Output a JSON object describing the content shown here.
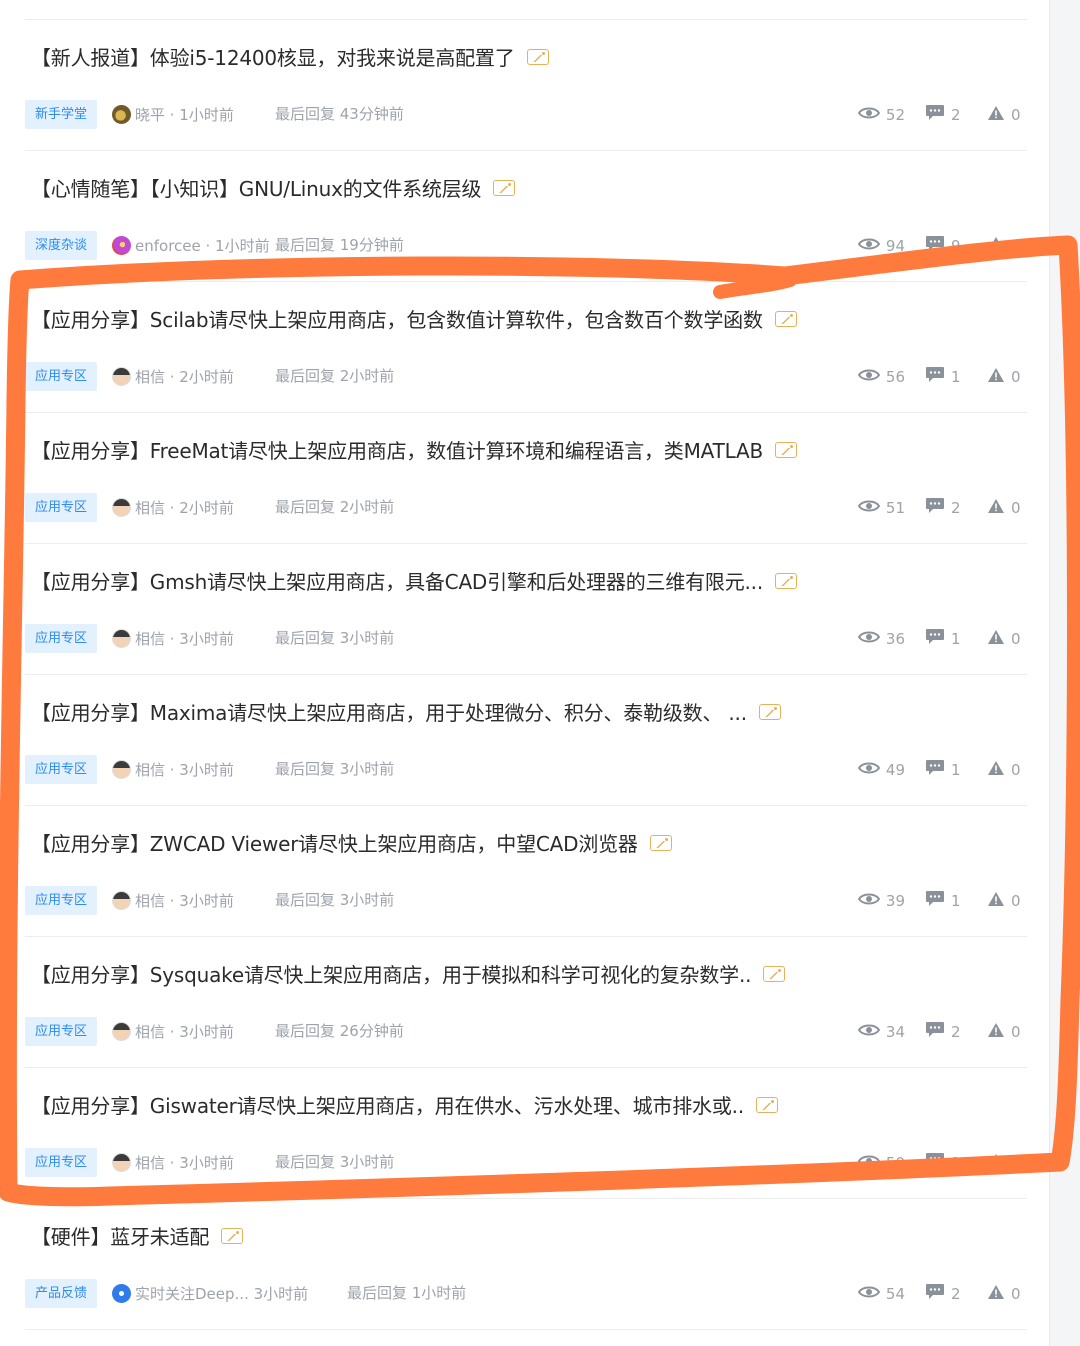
{
  "posts": [
    {
      "title": "【新人报道】体验i5-12400核显，对我来说是高配置了",
      "tag": "新手学堂",
      "author": "晓平 · 1小时前",
      "reply": "最后回复 43分钟前",
      "views": "52",
      "comments": "2",
      "reports": "0",
      "avatar": "xiaoping"
    },
    {
      "title": "【心情随笔】【小知识】GNU/Linux的文件系统层级",
      "tag": "深度杂谈",
      "author": "enforcee · 1小时前",
      "reply": "最后回复 19分钟前",
      "views": "94",
      "comments": "9",
      "reports": "0",
      "avatar": "enforcee"
    },
    {
      "title": "【应用分享】Scilab请尽快上架应用商店，包含数值计算软件，包含数百个数学函数",
      "tag": "应用专区",
      "author": "相信 · 2小时前",
      "reply": "最后回复 2小时前",
      "views": "56",
      "comments": "1",
      "reports": "0",
      "avatar": "xiangxin"
    },
    {
      "title": "【应用分享】FreeMat请尽快上架应用商店，数值计算环境和编程语言，类MATLAB",
      "tag": "应用专区",
      "author": "相信 · 2小时前",
      "reply": "最后回复 2小时前",
      "views": "51",
      "comments": "2",
      "reports": "0",
      "avatar": "xiangxin"
    },
    {
      "title": "【应用分享】Gmsh请尽快上架应用商店，具备CAD引擎和后处理器的三维有限元...",
      "tag": "应用专区",
      "author": "相信 · 3小时前",
      "reply": "最后回复 3小时前",
      "views": "36",
      "comments": "1",
      "reports": "0",
      "avatar": "xiangxin"
    },
    {
      "title": "【应用分享】Maxima请尽快上架应用商店，用于处理微分、积分、泰勒级数、 ...",
      "tag": "应用专区",
      "author": "相信 · 3小时前",
      "reply": "最后回复 3小时前",
      "views": "49",
      "comments": "1",
      "reports": "0",
      "avatar": "xiangxin"
    },
    {
      "title": "【应用分享】ZWCAD Viewer请尽快上架应用商店，中望CAD浏览器",
      "tag": "应用专区",
      "author": "相信 · 3小时前",
      "reply": "最后回复 3小时前",
      "views": "39",
      "comments": "1",
      "reports": "0",
      "avatar": "xiangxin"
    },
    {
      "title": "【应用分享】Sysquake请尽快上架应用商店，用于模拟和科学可视化的复杂数学..",
      "tag": "应用专区",
      "author": "相信 · 3小时前",
      "reply": "最后回复 26分钟前",
      "views": "34",
      "comments": "2",
      "reports": "0",
      "avatar": "xiangxin"
    },
    {
      "title": "【应用分享】Giswater请尽快上架应用商店，用在供水、污水处理、城市排水或..",
      "tag": "应用专区",
      "author": "相信 · 3小时前",
      "reply": "最后回复 3小时前",
      "views": "50",
      "comments": "1",
      "reports": "0",
      "avatar": "xiangxin"
    },
    {
      "title": "【硬件】蓝牙未适配",
      "tag": "产品反馈",
      "author": "实时关注Deep... 3小时前",
      "reply": "最后回复 1小时前",
      "views": "54",
      "comments": "2",
      "reports": "0",
      "avatar": "deep"
    }
  ],
  "icons": {
    "view": "eye-icon",
    "comment": "comment-icon",
    "report": "warning-icon",
    "image": "image-icon"
  },
  "colors": {
    "tag_bg": "#e3f0fd",
    "tag_text": "#2d8cf0",
    "annotation": "#ff7a3d"
  }
}
